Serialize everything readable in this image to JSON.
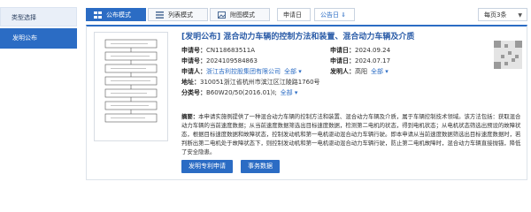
{
  "sidebar": {
    "title": "类型选择",
    "items": [
      {
        "label": "发明公布"
      }
    ]
  },
  "toolbar": {
    "view_modes": [
      {
        "label": "公布模式",
        "icon": "grid-icon",
        "active": true
      },
      {
        "label": "列表模式",
        "icon": "list-icon",
        "active": false
      },
      {
        "label": "附图模式",
        "icon": "image-icon",
        "active": false
      }
    ],
    "sort": [
      {
        "label": "申请日",
        "arrow": "↕"
      },
      {
        "label": "公告日",
        "arrow": "⇓"
      }
    ],
    "per_page": "每页3条",
    "per_page_caret": "▼"
  },
  "result": {
    "title": "[发明公布] 混合动力车辆的控制方法和装置、混合动力车辆及介质",
    "fields": {
      "application_no_label": "申请号：",
      "application_no": "CN118683511A",
      "application_date_label": "申请日：",
      "application_date": "2024.09.24",
      "pub_no_label": "申请号：",
      "pub_no": "2024109584863",
      "pub_date_label": "申请日：",
      "pub_date": "2024.07.17",
      "applicant_label": "申请人：",
      "applicant": "浙江吉利控股集团有限公司",
      "applicant_more": "全部 ▾",
      "inventor_label": "发明人：",
      "inventor": "高阳",
      "inventor_more": "全部 ▾",
      "address_label": "地址：",
      "address": "310051浙江省杭州市滨江区江陵路1760号",
      "classification_label": "分类号：",
      "classification": "B60W20/50(2016.01)I;",
      "classification_more": "全部 ▾"
    },
    "abstract_label": "摘要：",
    "abstract": "本申请实施例提供了一种混合动力车辆的控制方法和装置、混合动力车辆及介质，属于车辆控制技术领域。该方法包括：获取混合动力车辆的当前速度数据；从当前速度数据筛选出目标速度数据，检测第二电机的状态，得到电机状态；从电机状态筛选出预设的故障状态，根据目标速度数据和故障状态，控制发动机和第一电机驱动混合动力车辆行驶。即本申请从当前速度数据筛选出目标速度数据时，若判断出第二电机处于故障状态下，则控制发动机和第一电机驱动混合动力车辆行驶，防止第二电机故障时，混合动力车辆直接抛锚，降低了安全隐患。",
    "buttons": {
      "patent_apply": "发明专利申请",
      "legal_status": "事务数据"
    }
  }
}
